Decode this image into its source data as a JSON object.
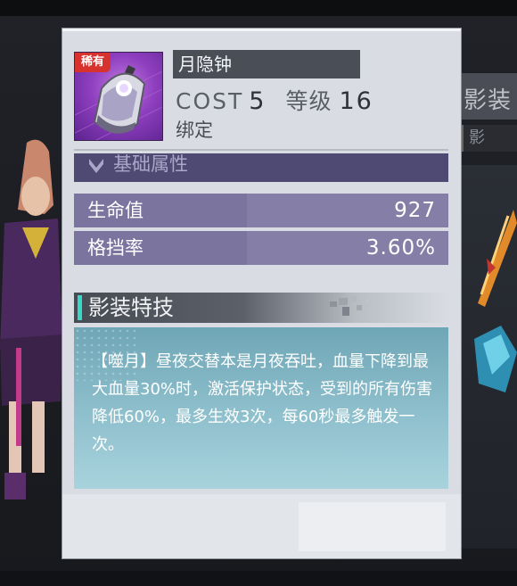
{
  "item": {
    "rarity_badge": "稀有",
    "name": "月隐钟",
    "cost_label": "COST",
    "cost_value": "5",
    "level_label": "等级",
    "level_value": "16",
    "bind_status": "绑定",
    "icon": "bell-charm-icon"
  },
  "attributes": {
    "section_title": "基础属性",
    "rows": [
      {
        "label": "生命值",
        "value": "927"
      },
      {
        "label": "格挡率",
        "value": "3.60%"
      }
    ]
  },
  "skill": {
    "section_title": "影装特技",
    "description": "【噬月】昼夜交替本是月夜吞吐，血量下降到最大血量30%时，激活保护状态，受到的所有伤害降低60%，最多生效3次，每60秒最多触发一次。"
  },
  "background": {
    "header_text": "影装",
    "subtab_text": "影"
  },
  "colors": {
    "rarity_red": "#d8322f",
    "attribute_purple": "#7a749e",
    "skill_teal": "#6fa6b6",
    "accent_cyan": "#39d8c6"
  }
}
